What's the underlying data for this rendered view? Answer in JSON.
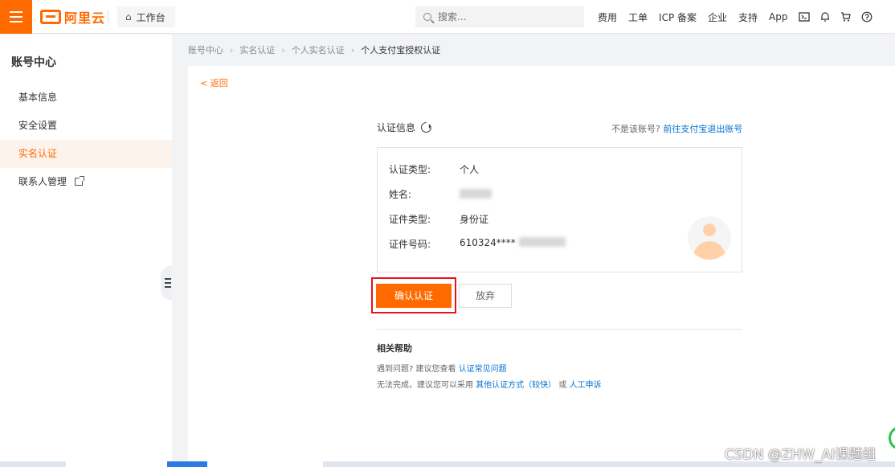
{
  "topbar": {
    "logo_text": "阿里云",
    "workbench_label": "工作台",
    "search_placeholder": "搜索...",
    "links": [
      "费用",
      "工单",
      "ICP 备案",
      "企业",
      "支持",
      "App"
    ],
    "icons": [
      "terminal-icon",
      "bell-icon",
      "cart-icon",
      "help-icon"
    ],
    "accent_color": "#ff6a00"
  },
  "sidebar": {
    "title": "账号中心",
    "items": [
      {
        "label": "基本信息"
      },
      {
        "label": "安全设置"
      },
      {
        "label": "实名认证",
        "active": true
      },
      {
        "label": "联系人管理",
        "external": true
      }
    ]
  },
  "breadcrumb": [
    "账号中心",
    "实名认证",
    "个人实名认证",
    "个人支付宝授权认证"
  ],
  "main": {
    "back_label": "< 返回",
    "info_title": "认证信息",
    "not_account_prefix": "不是该账号?",
    "not_account_link": "前往支付宝退出账号",
    "rows": [
      {
        "key": "认证类型:",
        "value": "个人"
      },
      {
        "key": "姓名:",
        "value": ""
      },
      {
        "key": "证件类型:",
        "value": "身份证"
      },
      {
        "key": "证件号码:",
        "value": "610324****"
      }
    ],
    "confirm_label": "确认认证",
    "giveup_label": "放弃",
    "help_title": "相关帮助",
    "help_line1_text": "遇到问题? 建议您查看",
    "help_line1_link": "认证常见问题",
    "help_line2_text": "无法完成，建议您可以采用",
    "help_line2_link1": "其他认证方式（较快）",
    "help_line2_or": "或",
    "help_line2_link2": "人工申诉"
  },
  "watermark": "CSDN @ZHW_AI课题组"
}
